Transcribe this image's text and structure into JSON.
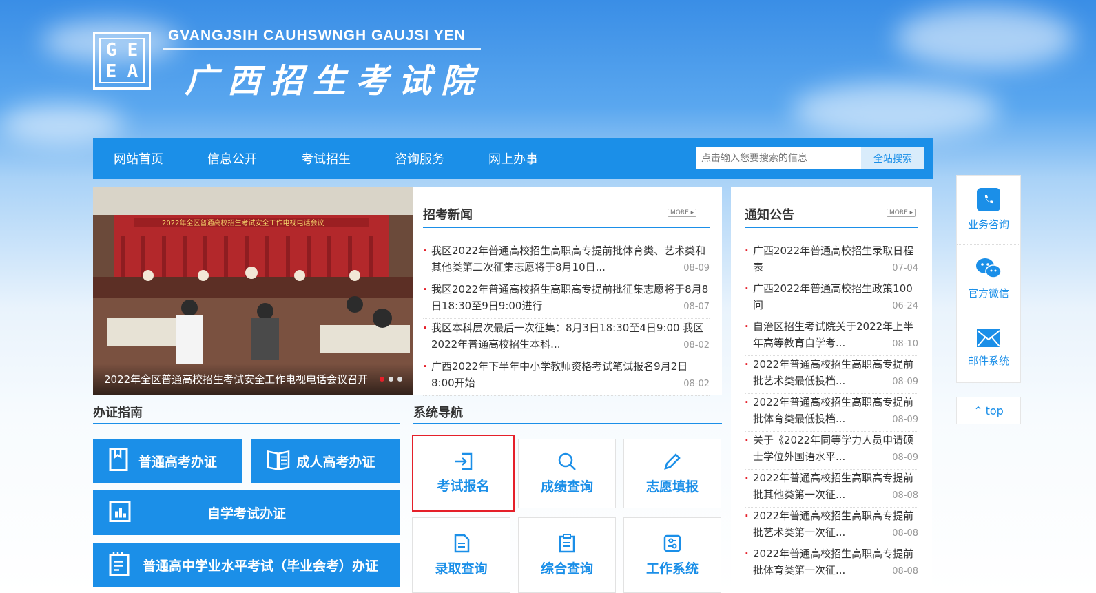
{
  "header": {
    "logo_letters": [
      "G",
      "E",
      "E",
      "A"
    ],
    "title_en": "GVANGJSIH CAUHSWNGH GAUJSI YEN",
    "title_cn": "广西招生考试院"
  },
  "nav": {
    "items": [
      "网站首页",
      "信息公开",
      "考试招生",
      "咨询服务",
      "网上办事"
    ],
    "search_placeholder": "点击输入您要搜索的信息",
    "search_button": "全站搜索"
  },
  "carousel": {
    "caption": "2022年全区普通高校招生考试安全工作电视电话会议召开",
    "banner_text": "2022年全区普通高校招生考试安全工作电视电话会议"
  },
  "news": {
    "title": "招考新闻",
    "more": "MORE",
    "items": [
      {
        "text": "我区2022年普通高校招生高职高专提前批体育类、艺术类和其他类第二次征集志愿将于8月10日...",
        "date": "08-09"
      },
      {
        "text": "我区2022年普通高校招生高职高专提前批征集志愿将于8月8日18:30至9日9:00进行",
        "date": "08-07"
      },
      {
        "text": "我区本科层次最后一次征集：8月3日18:30至4日9:00 我区2022年普通高校招生本科...",
        "date": "08-02"
      },
      {
        "text": "广西2022年下半年中小学教师资格考试笔试报名9月2日8:00开始",
        "date": "08-02"
      }
    ]
  },
  "notices": {
    "title": "通知公告",
    "more": "MORE",
    "items": [
      {
        "text": "广西2022年普通高校招生录取日程表",
        "date": "07-04"
      },
      {
        "text": "广西2022年普通高校招生政策100问",
        "date": "06-24"
      },
      {
        "text": "自治区招生考试院关于2022年上半年高等教育自学考...",
        "date": "08-10"
      },
      {
        "text": "2022年普通高校招生高职高专提前批艺术类最低投档...",
        "date": "08-09"
      },
      {
        "text": "2022年普通高校招生高职高专提前批体育类最低投档...",
        "date": "08-09"
      },
      {
        "text": "关于《2022年同等学力人员申请硕士学位外国语水平...",
        "date": "08-09"
      },
      {
        "text": "2022年普通高校招生高职高专提前批其他类第一次征...",
        "date": "08-08"
      },
      {
        "text": "2022年普通高校招生高职高专提前批艺术类第一次征...",
        "date": "08-08"
      },
      {
        "text": "2022年普通高校招生高职高专提前批体育类第一次征...",
        "date": "08-08"
      }
    ]
  },
  "guide": {
    "title": "办证指南",
    "buttons": [
      "普通高考办证",
      "成人高考办证",
      "自学考试办证",
      "普通高中学业水平考试（毕业会考）办证"
    ]
  },
  "system": {
    "title": "系统导航",
    "tiles": [
      "考试报名",
      "成绩查询",
      "志愿填报",
      "录取查询",
      "综合查询",
      "工作系统"
    ]
  },
  "float": {
    "items": [
      "业务咨询",
      "官方微信",
      "邮件系统"
    ],
    "top": "top"
  },
  "colors": {
    "primary": "#1b8fe8",
    "accent_red": "#e5202a"
  }
}
